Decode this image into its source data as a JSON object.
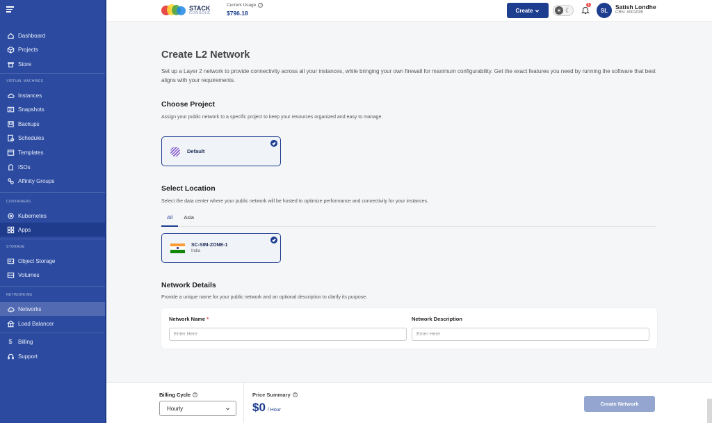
{
  "header": {
    "brand_line1": "STACK",
    "brand_line2": "CONSOLE",
    "usage_label": "Current Usage",
    "usage_value": "$796.18",
    "create_label": "Create",
    "notification_count": "1",
    "avatar_initials": "SL",
    "user_name": "Satish Londhe",
    "user_crn": "CRN: #001035"
  },
  "sidebar": {
    "items": {
      "dashboard": "Dashboard",
      "projects": "Projects",
      "store": "Store",
      "instances": "Instances",
      "snapshots": "Snapshots",
      "backups": "Backups",
      "schedules": "Schedules",
      "templates": "Templates",
      "isos": "ISOs",
      "affinity": "Affinity Groups",
      "kubernetes": "Kubernetes",
      "apps": "Apps",
      "object_storage": "Object Storage",
      "volumes": "Volumes",
      "networks": "Networks",
      "load_balancer": "Load Balancer",
      "billing": "Billing",
      "support": "Support"
    },
    "sections": {
      "vm": "VIRTUAL MACHINES",
      "containers": "CONTAINERS",
      "storage": "STORAGE",
      "networking": "NETWORKING"
    }
  },
  "main": {
    "title": "Create L2 Network",
    "description": "Set up a Layer 2 network to provide connectivity across all your instances, while bringing your own firewall for maximum configurability. Get the exact features you need by running the software that best aligns with your requirements.",
    "project": {
      "title": "Choose Project",
      "desc": "Assign your public network to a specific project to keep your resources organized and easy to manage.",
      "selected": "Default"
    },
    "location": {
      "title": "Select Location",
      "desc": "Select the data center where your public network will be hosted to optimize performance and connectivity for your instances.",
      "tabs": [
        "All",
        "Asia"
      ],
      "zone_name": "SC-SIM-ZONE-1",
      "zone_country": "India"
    },
    "details": {
      "title": "Network Details",
      "desc": "Provide a unique name for your public network and an optional description to clarify its purpose.",
      "name_label": "Network Name",
      "name_required": "*",
      "name_placeholder": "Enter Here",
      "name_value": "",
      "desc_label": "Network Description",
      "desc_placeholder": "Enter Here",
      "desc_value": ""
    }
  },
  "footer": {
    "billing_label": "Billing Cycle",
    "billing_value": "Hourly",
    "price_label": "Price Summary",
    "price_value": "$0",
    "price_unit": "/ Hour",
    "create_label": "Create Network"
  },
  "colors": {
    "sidebar": "#2b4aa0",
    "primary": "#1d3d8f",
    "disabled_button": "#94a6cf"
  }
}
